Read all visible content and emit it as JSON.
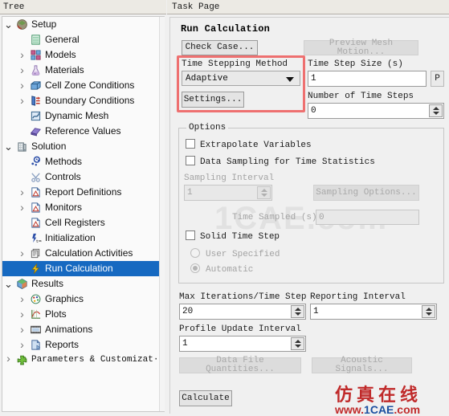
{
  "tree": {
    "header": "Tree",
    "items": [
      {
        "label": "Setup",
        "icon": "setup-icon",
        "indent": 0,
        "twisty": "open",
        "selected": false
      },
      {
        "label": "General",
        "icon": "general-icon",
        "indent": 1,
        "twisty": "none",
        "selected": false
      },
      {
        "label": "Models",
        "icon": "models-icon",
        "indent": 1,
        "twisty": "closed",
        "selected": false
      },
      {
        "label": "Materials",
        "icon": "materials-icon",
        "indent": 1,
        "twisty": "closed",
        "selected": false
      },
      {
        "label": "Cell Zone Conditions",
        "icon": "cell-zone-icon",
        "indent": 1,
        "twisty": "closed",
        "selected": false
      },
      {
        "label": "Boundary Conditions",
        "icon": "boundary-icon",
        "indent": 1,
        "twisty": "closed",
        "selected": false
      },
      {
        "label": "Dynamic Mesh",
        "icon": "dynamic-mesh-icon",
        "indent": 1,
        "twisty": "none",
        "selected": false
      },
      {
        "label": "Reference Values",
        "icon": "reference-values-icon",
        "indent": 1,
        "twisty": "none",
        "selected": false
      },
      {
        "label": "Solution",
        "icon": "solution-icon",
        "indent": 0,
        "twisty": "open",
        "selected": false
      },
      {
        "label": "Methods",
        "icon": "methods-icon",
        "indent": 1,
        "twisty": "none",
        "selected": false
      },
      {
        "label": "Controls",
        "icon": "controls-icon",
        "indent": 1,
        "twisty": "none",
        "selected": false
      },
      {
        "label": "Report Definitions",
        "icon": "report-definitions-icon",
        "indent": 1,
        "twisty": "closed",
        "selected": false
      },
      {
        "label": "Monitors",
        "icon": "monitors-icon",
        "indent": 1,
        "twisty": "closed",
        "selected": false
      },
      {
        "label": "Cell Registers",
        "icon": "cell-registers-icon",
        "indent": 1,
        "twisty": "none",
        "selected": false
      },
      {
        "label": "Initialization",
        "icon": "initialization-icon",
        "indent": 1,
        "twisty": "none",
        "selected": false
      },
      {
        "label": "Calculation Activities",
        "icon": "calculation-activities-icon",
        "indent": 1,
        "twisty": "closed",
        "selected": false
      },
      {
        "label": "Run Calculation",
        "icon": "run-calculation-icon",
        "indent": 1,
        "twisty": "none",
        "selected": true
      },
      {
        "label": "Results",
        "icon": "results-icon",
        "indent": 0,
        "twisty": "open",
        "selected": false
      },
      {
        "label": "Graphics",
        "icon": "graphics-icon",
        "indent": 1,
        "twisty": "closed",
        "selected": false
      },
      {
        "label": "Plots",
        "icon": "plots-icon",
        "indent": 1,
        "twisty": "closed",
        "selected": false
      },
      {
        "label": "Animations",
        "icon": "animations-icon",
        "indent": 1,
        "twisty": "closed",
        "selected": false
      },
      {
        "label": "Reports",
        "icon": "reports-icon",
        "indent": 1,
        "twisty": "closed",
        "selected": false
      },
      {
        "label": "Parameters & Customizat···",
        "icon": "parameters-icon",
        "indent": 0,
        "twisty": "closed",
        "selected": false
      }
    ]
  },
  "task": {
    "header": "Task Page",
    "title": "Run Calculation",
    "check_case_button": "Check Case...",
    "preview_mesh_motion_button": "Preview Mesh Motion...",
    "time_stepping_method_label": "Time Stepping Method",
    "time_stepping_method_value": "Adaptive",
    "settings_button": "Settings...",
    "time_step_size_label": "Time Step Size (s)",
    "time_step_size_value": "1",
    "profile_button": "P",
    "number_of_time_steps_label": "Number of Time Steps",
    "number_of_time_steps_value": "0",
    "options_group_label": "Options",
    "extrapolate_variables_label": "Extrapolate Variables",
    "data_sampling_label": "Data Sampling for Time Statistics",
    "sampling_interval_label": "Sampling Interval",
    "sampling_interval_value": "1",
    "sampling_options_button": "Sampling Options...",
    "time_sampled_label": "Time Sampled (s)",
    "time_sampled_value": "0",
    "solid_time_step_label": "Solid Time Step",
    "user_specified_label": "User Specified",
    "automatic_label": "Automatic",
    "max_iterations_label": "Max Iterations/Time Step",
    "max_iterations_value": "20",
    "reporting_interval_label": "Reporting Interval",
    "reporting_interval_value": "1",
    "profile_update_interval_label": "Profile Update Interval",
    "profile_update_interval_value": "1",
    "data_file_quantities_button": "Data File Quantities...",
    "acoustic_signals_button": "Acoustic Signals...",
    "calculate_button": "Calculate"
  },
  "highlight": {
    "color": "#ee7070"
  },
  "watermark": {
    "cn": "仿真在线",
    "url_www": "www.",
    "url_name": "1CAE",
    "url_tld": ".com",
    "ghost": "1CAE.com"
  }
}
